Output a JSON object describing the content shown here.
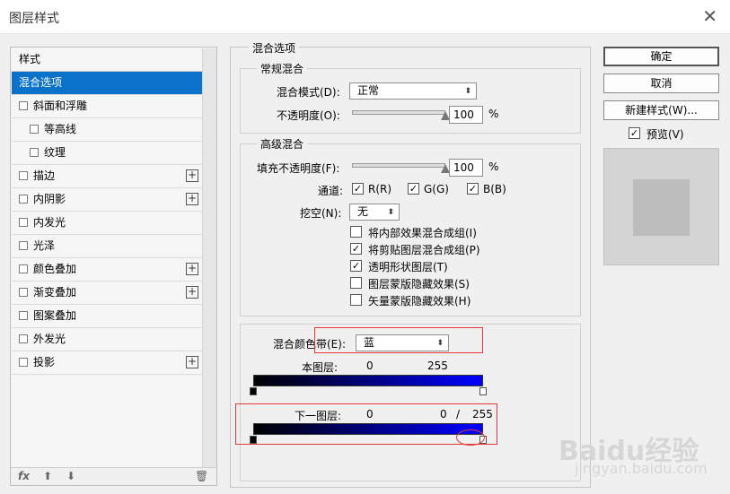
{
  "window": {
    "title": "图层样式",
    "close_glyph": "✕"
  },
  "styles_panel": {
    "items": [
      {
        "label": "样式",
        "checkbox": false,
        "plus": false,
        "indent": false,
        "selected": false,
        "header": true
      },
      {
        "label": "混合选项",
        "checkbox": false,
        "plus": false,
        "indent": false,
        "selected": true
      },
      {
        "label": "斜面和浮雕",
        "checkbox": true,
        "plus": false,
        "indent": false,
        "selected": false
      },
      {
        "label": "等高线",
        "checkbox": true,
        "plus": false,
        "indent": true,
        "selected": false
      },
      {
        "label": "纹理",
        "checkbox": true,
        "plus": false,
        "indent": true,
        "selected": false
      },
      {
        "label": "描边",
        "checkbox": true,
        "plus": true,
        "indent": false,
        "selected": false
      },
      {
        "label": "内阴影",
        "checkbox": true,
        "plus": true,
        "indent": false,
        "selected": false
      },
      {
        "label": "内发光",
        "checkbox": true,
        "plus": false,
        "indent": false,
        "selected": false
      },
      {
        "label": "光泽",
        "checkbox": true,
        "plus": false,
        "indent": false,
        "selected": false
      },
      {
        "label": "颜色叠加",
        "checkbox": true,
        "plus": true,
        "indent": false,
        "selected": false
      },
      {
        "label": "渐变叠加",
        "checkbox": true,
        "plus": true,
        "indent": false,
        "selected": false
      },
      {
        "label": "图案叠加",
        "checkbox": true,
        "plus": false,
        "indent": false,
        "selected": false
      },
      {
        "label": "外发光",
        "checkbox": true,
        "plus": false,
        "indent": false,
        "selected": false
      },
      {
        "label": "投影",
        "checkbox": true,
        "plus": true,
        "indent": false,
        "selected": false
      }
    ],
    "footer": {
      "fx_label": "fx",
      "up_glyph": "⬆",
      "down_glyph": "⬇",
      "trash_glyph": "🗑"
    }
  },
  "blending": {
    "section_title": "混合选项",
    "general": {
      "title": "常规混合",
      "mode_label": "混合模式(D):",
      "mode_value": "正常",
      "opacity_label": "不透明度(O):",
      "opacity_value": "100",
      "opacity_unit": "%",
      "opacity_fraction": 1.0
    },
    "advanced": {
      "title": "高级混合",
      "fill_label": "填充不透明度(F):",
      "fill_value": "100",
      "fill_unit": "%",
      "fill_fraction": 1.0,
      "channels_label": "通道:",
      "channels": [
        {
          "label": "R(R)",
          "checked": true
        },
        {
          "label": "G(G)",
          "checked": true
        },
        {
          "label": "B(B)",
          "checked": true
        }
      ],
      "knockout_label": "挖空(N):",
      "knockout_value": "无",
      "options": [
        {
          "label": "将内部效果混合成组(I)",
          "checked": false
        },
        {
          "label": "将剪贴图层混合成组(P)",
          "checked": true
        },
        {
          "label": "透明形状图层(T)",
          "checked": true
        },
        {
          "label": "图层蒙版隐藏效果(S)",
          "checked": false
        },
        {
          "label": "矢量蒙版隐藏效果(H)",
          "checked": false
        }
      ]
    },
    "blend_if": {
      "label": "混合颜色带(E):",
      "value": "蓝",
      "this_layer_label": "本图层:",
      "this_layer_low": "0",
      "this_layer_high": "255",
      "underlying_label": "下一图层:",
      "underlying_low": "0",
      "underlying_high_a": "0",
      "underlying_sep": "/",
      "underlying_high_b": "255",
      "gradient_start_color": "#000000",
      "gradient_end_color": "#0000ff"
    }
  },
  "buttons": {
    "ok": "确定",
    "cancel": "取消",
    "new_style": "新建样式(W)...",
    "preview_label": "预览(V)",
    "preview_checked": true
  },
  "watermark": {
    "brand": "Baidu经验",
    "url": "jingyan.baidu.com"
  },
  "colors": {
    "accent": "#0a72c9",
    "annotation_red": "#e23a3a"
  }
}
